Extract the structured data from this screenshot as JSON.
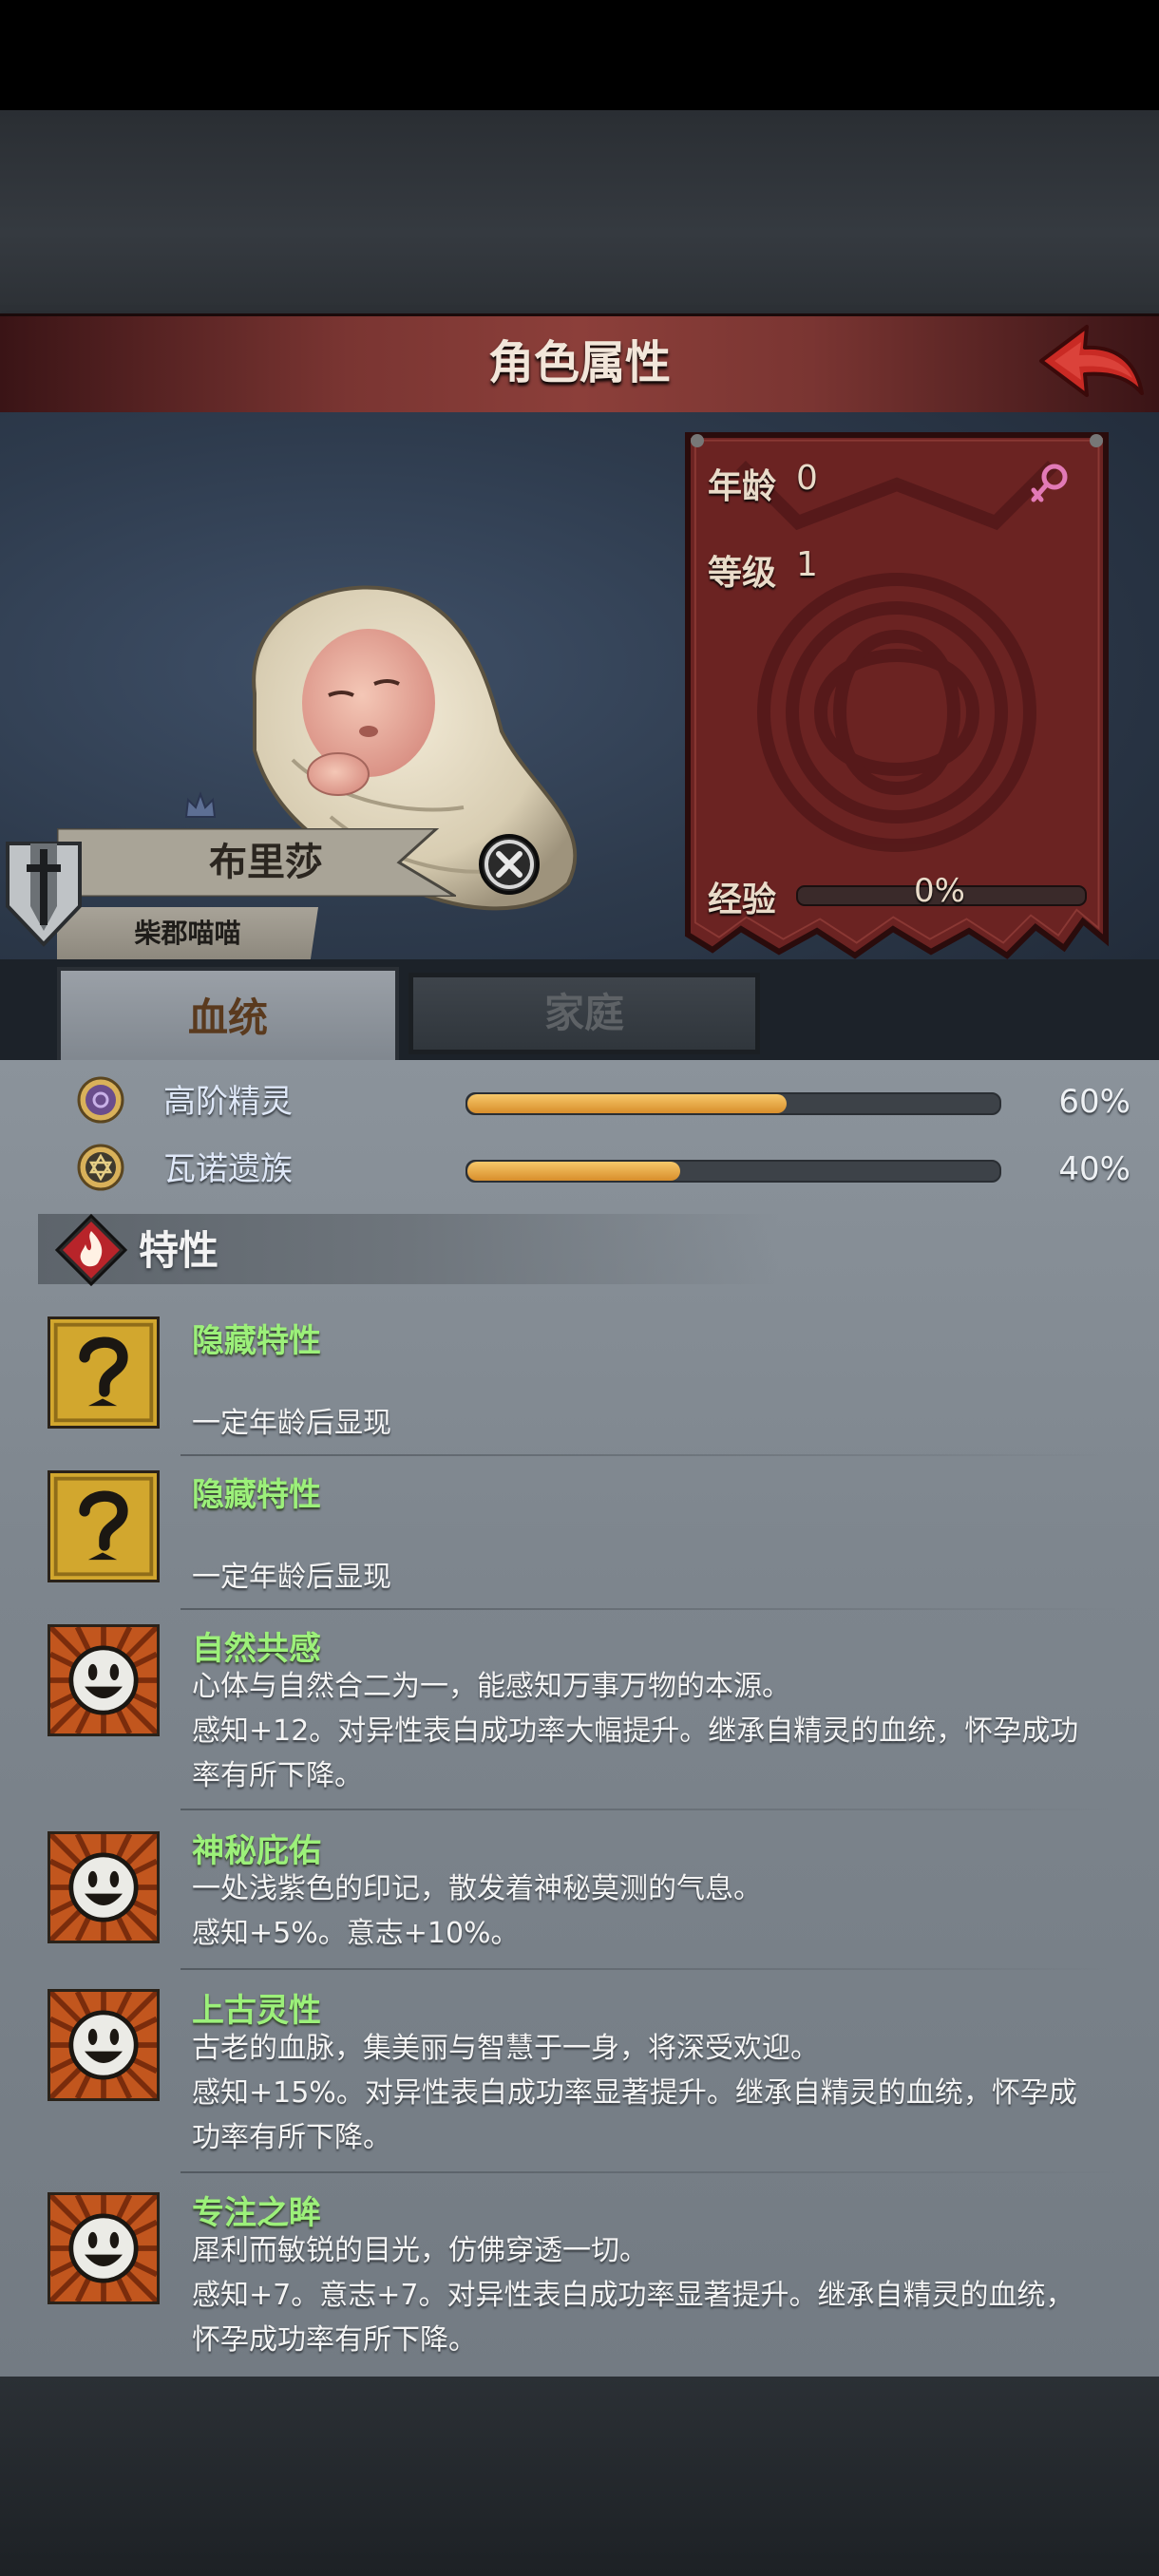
{
  "header": {
    "title": "角色属性"
  },
  "character": {
    "name": "布里莎",
    "subtitle": "柴郡喵喵"
  },
  "stats": {
    "age_label": "年龄",
    "age_value": "0",
    "level_label": "等级",
    "level_value": "1",
    "exp_label": "经验",
    "exp_value": "0%",
    "exp_fraction": 0
  },
  "tabs": [
    {
      "label": "血统",
      "active": true
    },
    {
      "label": "家庭",
      "active": false
    }
  ],
  "bloodlines": [
    {
      "name": "高阶精灵",
      "percent": "60%",
      "fraction": 0.6,
      "icon": "elf-sigil-icon"
    },
    {
      "name": "瓦诺遗族",
      "percent": "40%",
      "fraction": 0.4,
      "icon": "hexagram-sigil-icon"
    }
  ],
  "traits_section": {
    "title": "特性"
  },
  "traits": [
    {
      "name": "隐藏特性",
      "icon": "question-mark-icon",
      "desc": [
        "",
        "一定年龄后显现"
      ]
    },
    {
      "name": "隐藏特性",
      "icon": "question-mark-icon",
      "desc": [
        "",
        "一定年龄后显现"
      ]
    },
    {
      "name": "自然共感",
      "icon": "smiley-icon",
      "desc": [
        "心体与自然合二为一，能感知万事万物的本源。",
        "感知+12。对异性表白成功率大幅提升。继承自精灵的血统，怀孕成功",
        "率有所下降。"
      ]
    },
    {
      "name": "神秘庇佑",
      "icon": "smiley-icon",
      "desc": [
        "一处浅紫色的印记，散发着神秘莫测的气息。",
        "感知+5%。意志+10%。"
      ]
    },
    {
      "name": "上古灵性",
      "icon": "smiley-icon",
      "desc": [
        "古老的血脉，集美丽与智慧于一身，将深受欢迎。",
        "感知+15%。对异性表白成功率显著提升。继承自精灵的血统，怀孕成",
        "功率有所下降。"
      ]
    },
    {
      "name": "专注之眸",
      "icon": "smiley-icon",
      "desc": [
        "犀利而敏锐的目光，仿佛穿透一切。",
        "感知+7。意志+7。对异性表白成功率显著提升。继承自精灵的血统，",
        "怀孕成功率有所下降。"
      ]
    }
  ],
  "colors": {
    "header": "#8c3f3a",
    "trait_name": "#9cf07a",
    "bar_fill": "#e8a843",
    "female_symbol": "#e27ab6"
  }
}
